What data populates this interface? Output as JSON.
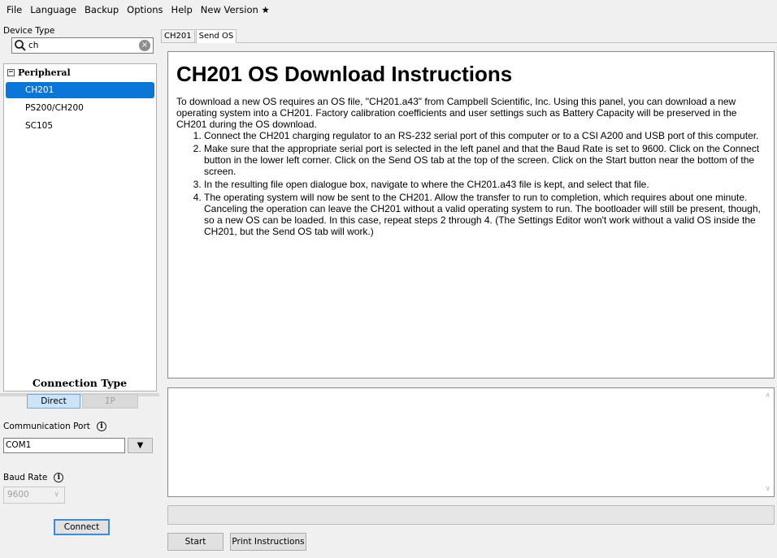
{
  "menu": [
    "File",
    "Language",
    "Backup",
    "Options",
    "Help",
    "New Version ★"
  ],
  "sidebar": {
    "device_type_label": "Device Type",
    "search_value": "ch",
    "search_clear": "×",
    "group_toggle": "−",
    "group_label": "Peripheral",
    "items": [
      {
        "label": "CH201",
        "selected": true
      },
      {
        "label": "PS200/CH200",
        "selected": false
      },
      {
        "label": "SC105",
        "selected": false
      }
    ],
    "connection_type_title": "Connection Type",
    "connection_direct": "Direct",
    "connection_ip": "IP",
    "comm_port_label": "Communication Port",
    "comm_port_value": "COM1",
    "dropdown_arrow": "▼",
    "baud_rate_label": "Baud Rate",
    "baud_rate_value": "9600",
    "baud_chevron": "∨",
    "info_glyph": "i",
    "connect_label": "Connect"
  },
  "tabs": [
    {
      "label": "CH201",
      "active": false
    },
    {
      "label": "Send OS",
      "active": true
    }
  ],
  "instructions": {
    "title": "CH201 OS Download Instructions",
    "intro": "To download a new OS requires an OS file, \"CH201.a43\" from Campbell Scientific, Inc. Using this panel, you can download a new operating system into a CH201. Factory calibration coefficients and user settings such as Battery Capacity will be preserved in the CH201 during the OS download.",
    "steps": [
      "Connect the CH201 charging regulator to an RS-232 serial port of this computer or to a CSI A200 and USB port of this computer.",
      "Make sure that the appropriate serial port is selected in the left panel and that the Baud Rate is set to 9600. Click on the Connect button in the lower left corner. Click on the Send OS tab at the top of the screen. Click on the Start button near the bottom of the screen.",
      "In the resulting file open dialogue box, navigate to where the CH201.a43 file is kept, and select that file.",
      "The operating system will now be sent to the CH201. Allow the transfer to run to completion, which requires about one minute. Canceling the operation can leave the CH201 without a valid operating system to run. The bootloader will still be present, though, so a new OS can be loaded. In this case, repeat steps 2 through 4. (The Settings Editor won't work without a valid OS inside the CH201, but the Send OS tab will work.)"
    ]
  },
  "log": {
    "up_arrow": "∧",
    "down_arrow": "∨"
  },
  "progress": 0,
  "buttons": {
    "start": "Start",
    "print": "Print Instructions"
  },
  "colors": {
    "selection": "#0a76d7",
    "direct_active": "#cce4f7",
    "progress_fill": "#06b025"
  }
}
